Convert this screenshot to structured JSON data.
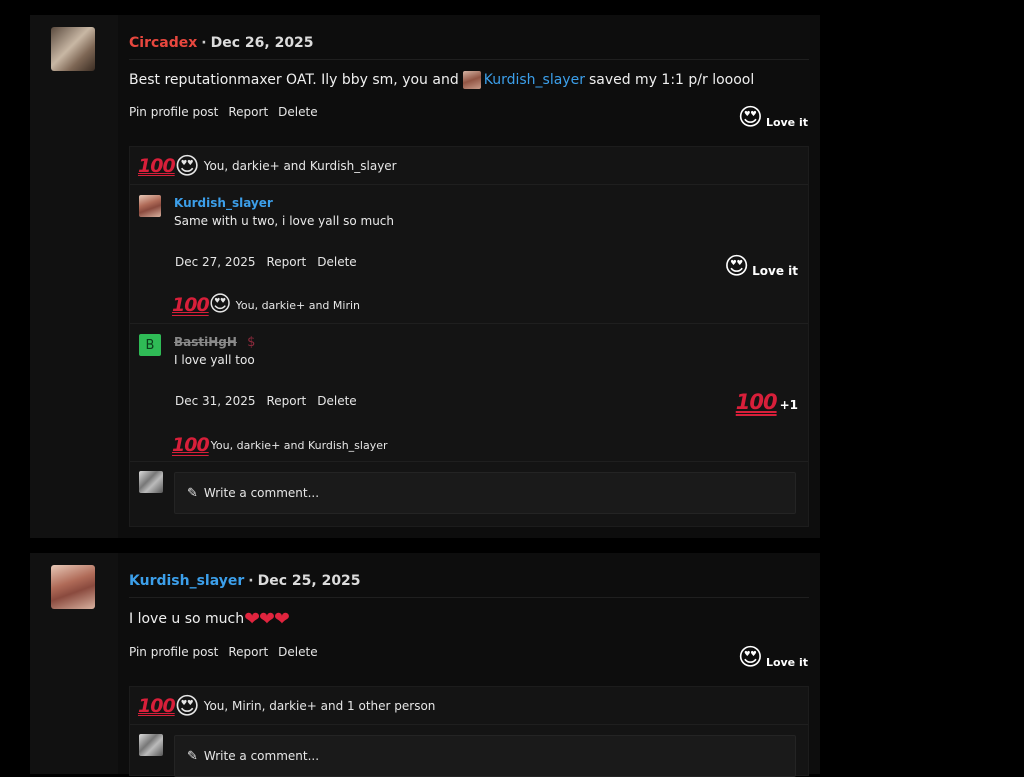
{
  "posts": [
    {
      "author": "Circadex",
      "date": "Dec 26, 2025",
      "text_before": "Best reputationmaxer OAT. Ily bby sm, you and",
      "mention": "Kurdish_slayer",
      "text_after": "saved my 1:1 p/r looool",
      "actions": [
        "Pin profile post",
        "Report",
        "Delete"
      ],
      "reaction_label": "Love it",
      "summary": "You, darkie+ and Kurdish_slayer",
      "comments": [
        {
          "author": "Kurdish_slayer",
          "text": "Same with u two, i love yall so much",
          "date": "Dec 27, 2025",
          "actions": [
            "Report",
            "Delete"
          ],
          "reaction_label": "Love it",
          "summary": "You, darkie+ and Mirin"
        },
        {
          "avatar_letter": "B",
          "author": "BastiHgH",
          "badge": "$",
          "text": "I love yall too",
          "date": "Dec 31, 2025",
          "actions": [
            "Report",
            "Delete"
          ],
          "reaction_count": "+1",
          "summary": "You, darkie+ and Kurdish_slayer"
        }
      ],
      "write_placeholder": "Write a comment..."
    },
    {
      "author": "Kurdish_slayer",
      "date": "Dec 25, 2025",
      "text": "I love u so much",
      "hearts": "❤❤❤",
      "actions": [
        "Pin profile post",
        "Report",
        "Delete"
      ],
      "reaction_label": "Love it",
      "summary": "You, Mirin, darkie+ and 1 other person",
      "write_placeholder": "Write a comment..."
    }
  ],
  "icons": {
    "heart_eyes": "😍",
    "hundred": "100",
    "pencil": "✎",
    "separator": "·"
  }
}
